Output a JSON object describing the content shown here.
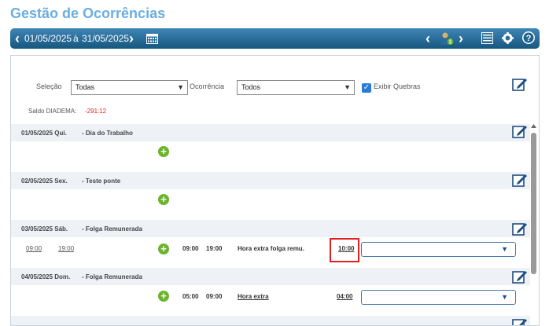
{
  "title": "Gestão de Ocorrências",
  "toolbar": {
    "date_from": "01/05/2025",
    "date_sep": "à",
    "date_to": "31/05/2025"
  },
  "filters": {
    "selecao_label": "Seleção",
    "selecao_value": "Todas",
    "ocorrencia_label": "Ocorrência",
    "ocorrencia_value": "Todos",
    "exibir_quebras_label": "Exibir Quebras",
    "exibir_quebras_checked": true
  },
  "saldo": {
    "label": "Saldo DIADEMA:",
    "value": "-291:12",
    "color": "#e02020"
  },
  "days": [
    {
      "date": "01/05/2025 Qui.",
      "desc": "- Dia do Trabalho"
    },
    {
      "date": "02/05/2025 Sex.",
      "desc": "- Teste ponte"
    },
    {
      "date": "03/05/2025 Sáb.",
      "desc": "- Folga Remunerada",
      "entry": {
        "marc1": "09:00",
        "marc2": "19:00",
        "start": "09:00",
        "end": "19:00",
        "type": "Hora extra folga remu.",
        "hours": "10:00"
      }
    },
    {
      "date": "04/05/2025 Dom.",
      "desc": "- Folga Remunerada",
      "entry": {
        "start": "05:00",
        "end": "09:00",
        "type": "Hora extra",
        "hours": "04:00"
      }
    }
  ],
  "colors": {
    "title": "#6aaee0",
    "toolbar": "#1f6590",
    "highlight": "#e02020"
  }
}
